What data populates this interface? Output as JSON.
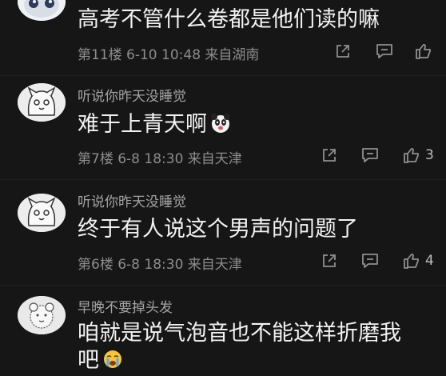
{
  "comments": [
    {
      "username": "",
      "content": "高考不管什么卷都是他们读的嘛",
      "meta": "第11楼  6-10 10:48  来自湖南",
      "likes": "",
      "avatar_icon": "cat-sticker-avatar"
    },
    {
      "username": "听说你昨天没睡觉",
      "content": "难于上青天啊",
      "content_emoji": "panda-emoji",
      "meta": "第7楼  6-8 18:30  来自天津",
      "likes": "3",
      "avatar_icon": "cartoon-cat-avatar"
    },
    {
      "username": "听说你昨天没睡觉",
      "content": "终于有人说这个男声的问题了",
      "meta": "第6楼  6-8 18:30  来自天津",
      "likes": "4",
      "avatar_icon": "cartoon-cat-avatar"
    },
    {
      "username": "早晚不要掉头发",
      "content_line1": "咱就是说气泡音也不能这样折磨我",
      "content_line2": "吧",
      "content_emoji": "crying-emoji",
      "meta": "",
      "likes": "",
      "avatar_icon": "sketch-bear-avatar"
    }
  ],
  "icons": {
    "share": "share-icon",
    "reply": "reply-icon",
    "like": "thumbs-up-icon"
  }
}
